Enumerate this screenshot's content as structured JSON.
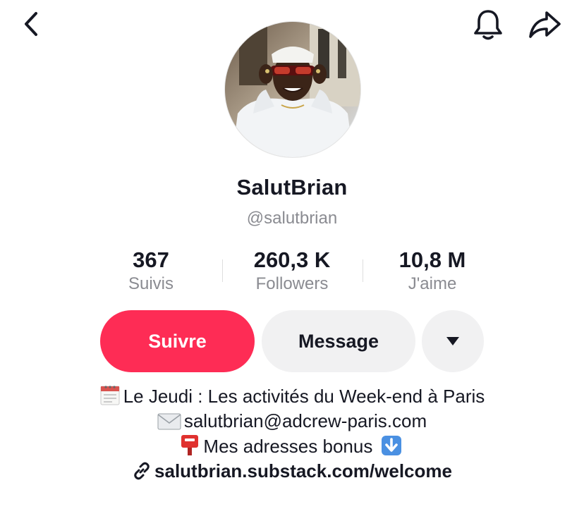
{
  "profile": {
    "display_name": "SalutBrian",
    "handle": "@salutbrian"
  },
  "stats": [
    {
      "value": "367",
      "label": "Suivis"
    },
    {
      "value": "260,3 K",
      "label": "Followers"
    },
    {
      "value": "10,8 M",
      "label": "J'aime"
    }
  ],
  "actions": {
    "follow_label": "Suivre",
    "message_label": "Message"
  },
  "bio": {
    "line1": "Le Jeudi : Les activités du Week-end à Paris",
    "line2": "salutbrian@adcrew-paris.com",
    "line3": "Mes adresses bonus",
    "link": "salutbrian.substack.com/welcome"
  },
  "icons": {
    "back": "chevron-left-icon",
    "bell": "bell-icon",
    "share": "share-arrow-icon",
    "more": "caret-down-icon",
    "calendar": "calendar-icon",
    "envelope": "envelope-icon",
    "mailbox": "mailbox-icon",
    "down_arrow": "down-arrow-icon",
    "link": "link-icon"
  },
  "colors": {
    "accent": "#fe2c55",
    "secondary_button": "#f1f1f2",
    "muted_text": "#8a8b91"
  }
}
